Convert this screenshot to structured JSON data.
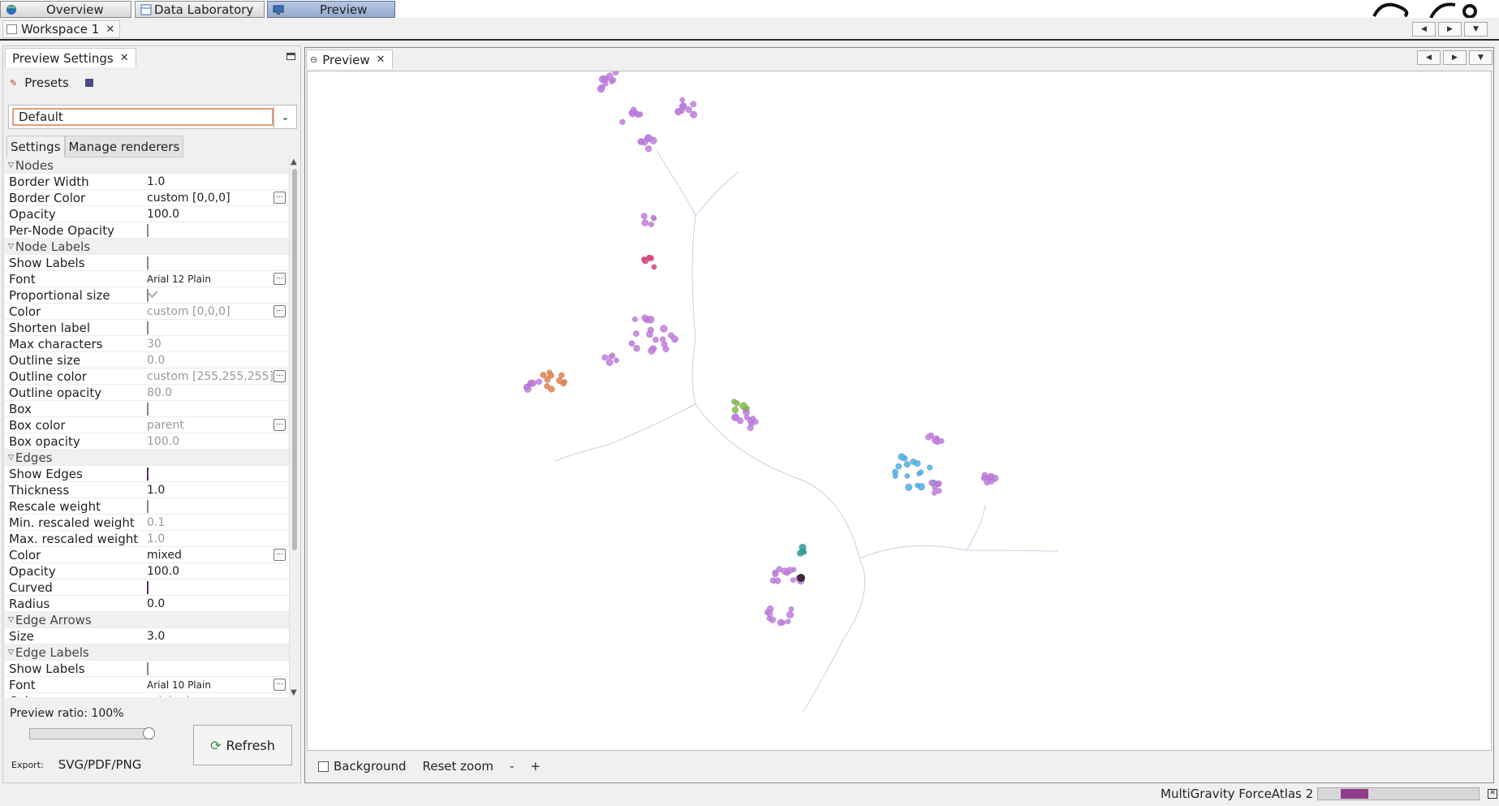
{
  "top_tabs": [
    {
      "label": "Overview",
      "icon": "globe-icon"
    },
    {
      "label": "Data Laboratory",
      "icon": "table-icon"
    },
    {
      "label": "Preview",
      "icon": "monitor-icon"
    }
  ],
  "workspace": {
    "tab_label": "Workspace 1"
  },
  "left_panel": {
    "tab_label": "Preview Settings",
    "presets_label": "Presets",
    "preset_value": "Default",
    "subtabs": [
      "Settings",
      "Manage renderers"
    ],
    "properties": [
      {
        "type": "cat",
        "label": "Nodes"
      },
      {
        "type": "text",
        "label": "Border Width",
        "value": "1.0"
      },
      {
        "type": "text",
        "label": "Border Color",
        "value": "custom [0,0,0]",
        "dots": true
      },
      {
        "type": "text",
        "label": "Opacity",
        "value": "100.0"
      },
      {
        "type": "check",
        "label": "Per-Node Opacity",
        "checked": false
      },
      {
        "type": "cat",
        "label": "Node Labels"
      },
      {
        "type": "check",
        "label": "Show Labels",
        "checked": false
      },
      {
        "type": "text",
        "label": "Font",
        "value": "Arial 12 Plain",
        "dots": true,
        "small": true
      },
      {
        "type": "check",
        "label": "Proportional size",
        "checked": false,
        "dimcheck": true
      },
      {
        "type": "text",
        "label": "Color",
        "value": "custom [0,0,0]",
        "dots": true,
        "disabled": true
      },
      {
        "type": "check",
        "label": "Shorten label",
        "checked": false
      },
      {
        "type": "text",
        "label": "Max characters",
        "value": "30",
        "disabled": true
      },
      {
        "type": "text",
        "label": "Outline size",
        "value": "0.0",
        "disabled": true
      },
      {
        "type": "text",
        "label": "Outline color",
        "value": "custom [255,255,255]",
        "dots": true,
        "disabled": true
      },
      {
        "type": "text",
        "label": "Outline opacity",
        "value": "80.0",
        "disabled": true
      },
      {
        "type": "check",
        "label": "Box",
        "checked": false
      },
      {
        "type": "text",
        "label": "Box color",
        "value": "parent",
        "dots": true,
        "disabled": true
      },
      {
        "type": "text",
        "label": "Box opacity",
        "value": "100.0",
        "disabled": true
      },
      {
        "type": "cat",
        "label": "Edges"
      },
      {
        "type": "check",
        "label": "Show Edges",
        "checked": true
      },
      {
        "type": "text",
        "label": "Thickness",
        "value": "1.0"
      },
      {
        "type": "check",
        "label": "Rescale weight",
        "checked": false
      },
      {
        "type": "text",
        "label": "Min. rescaled weight",
        "value": "0.1",
        "disabled": true
      },
      {
        "type": "text",
        "label": "Max. rescaled weight",
        "value": "1.0",
        "disabled": true
      },
      {
        "type": "text",
        "label": "Color",
        "value": "mixed",
        "dots": true
      },
      {
        "type": "text",
        "label": "Opacity",
        "value": "100.0"
      },
      {
        "type": "check",
        "label": "Curved",
        "checked": true
      },
      {
        "type": "text",
        "label": "Radius",
        "value": "0.0"
      },
      {
        "type": "cat",
        "label": "Edge Arrows"
      },
      {
        "type": "text",
        "label": "Size",
        "value": "3.0"
      },
      {
        "type": "cat",
        "label": "Edge Labels"
      },
      {
        "type": "check",
        "label": "Show Labels",
        "checked": false
      },
      {
        "type": "text",
        "label": "Font",
        "value": "Arial 10 Plain",
        "dots": true,
        "small": true
      },
      {
        "type": "text",
        "label": "Color",
        "value": "original",
        "disabled": true
      }
    ],
    "ratio_label": "Preview ratio:",
    "ratio_value": "100%",
    "refresh_label": "Refresh",
    "export_label": "Export:",
    "export_formats": "SVG/PDF/PNG"
  },
  "preview": {
    "tab_label": "Preview",
    "background_label": "Background",
    "reset_zoom_label": "Reset zoom",
    "zoom_out_label": "-",
    "zoom_in_label": "+"
  },
  "status": {
    "algorithm_label": "MultiGravity ForceAtlas 2",
    "progress": 0.2
  },
  "colors": {
    "accent": "#7a3e74",
    "node_default": "#c27be0",
    "progress_fill": "#8e3e89"
  }
}
